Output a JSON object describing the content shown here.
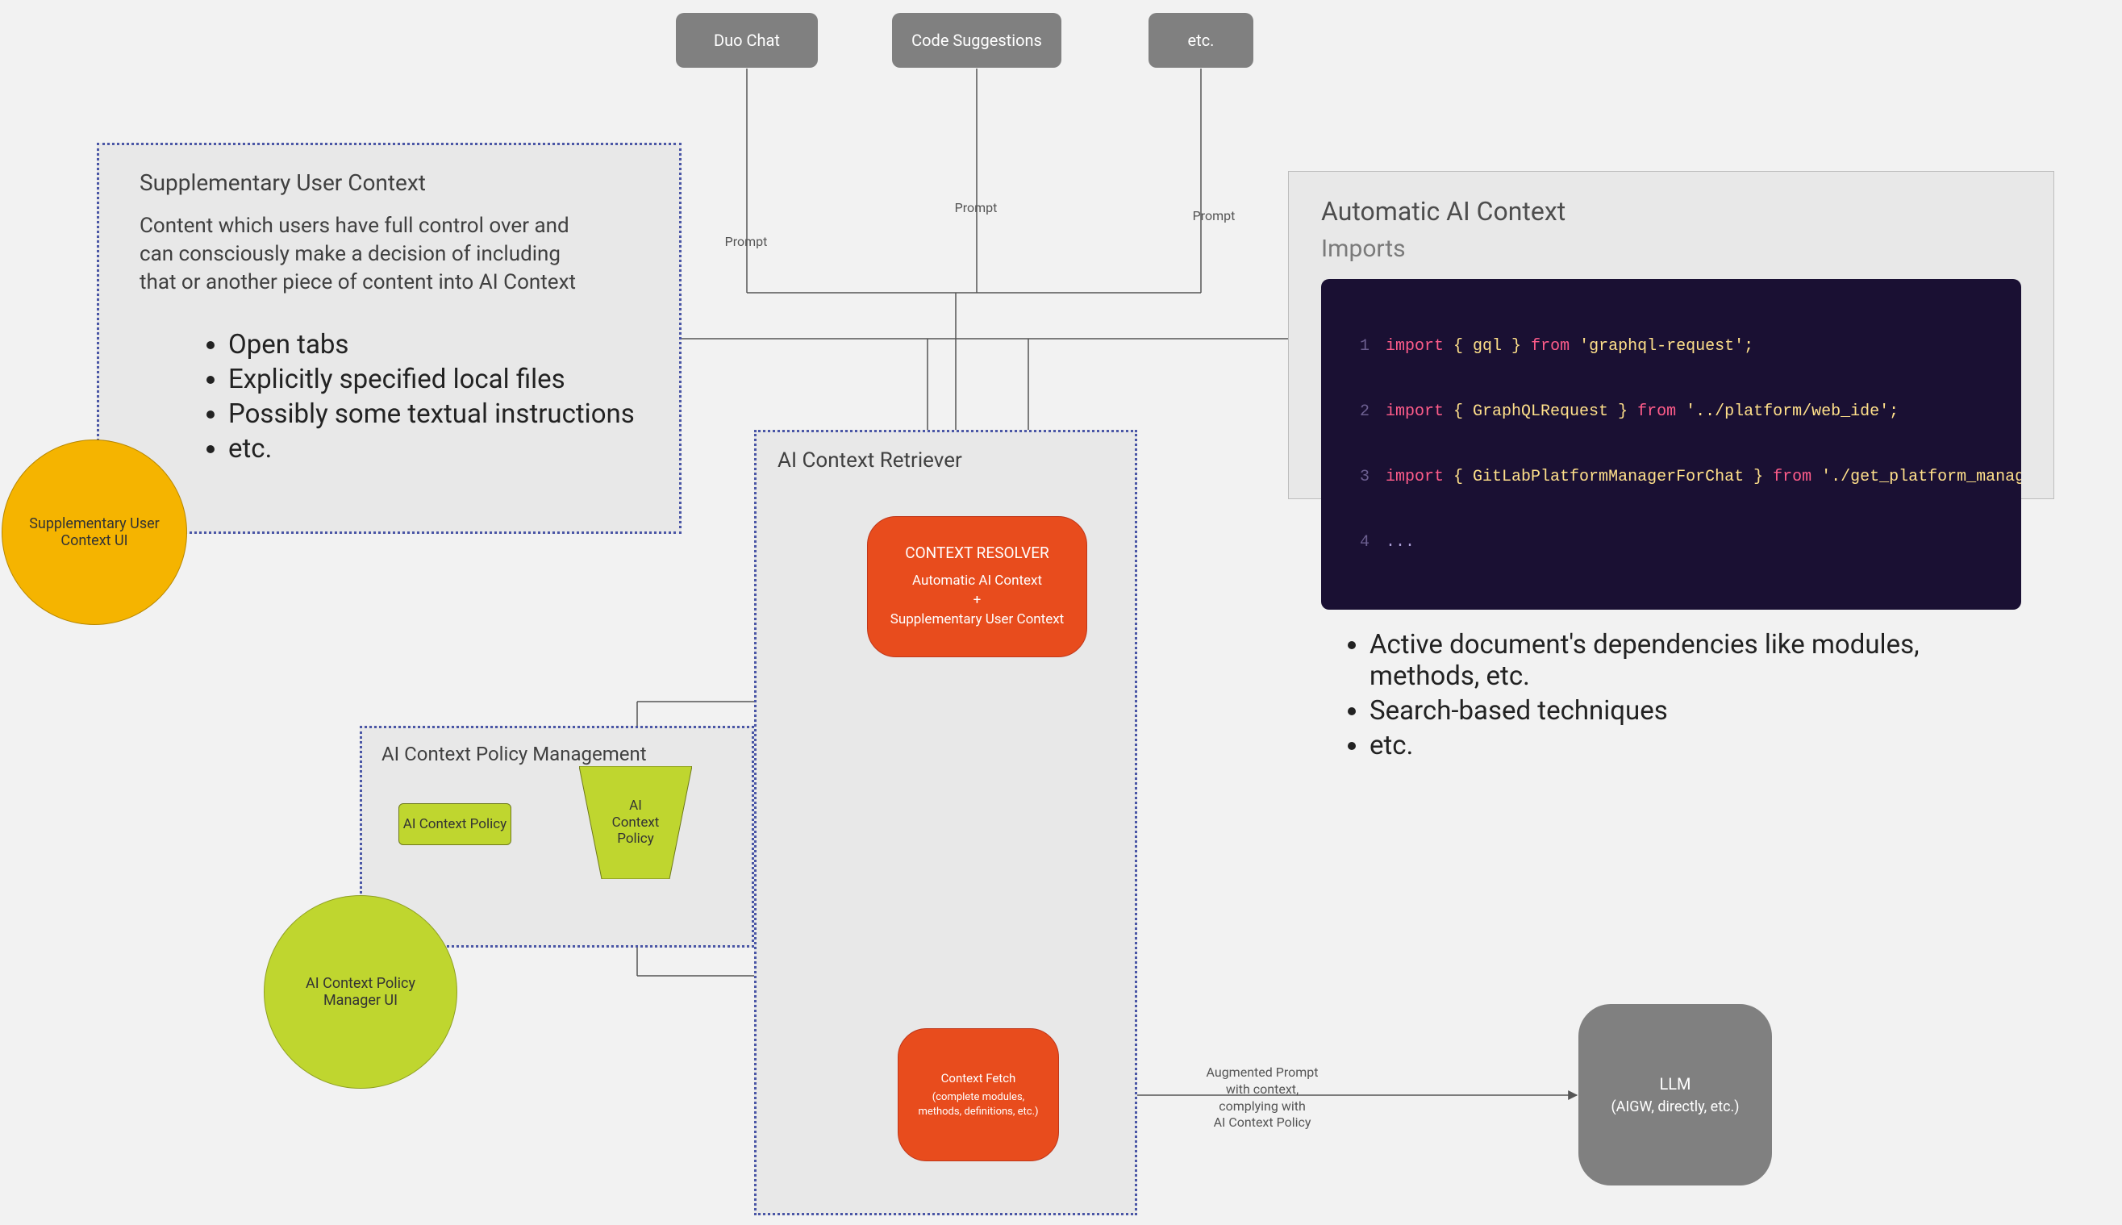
{
  "top_boxes": {
    "duo_chat": "Duo Chat",
    "code_suggestions": "Code Suggestions",
    "etc": "etc."
  },
  "edge_labels": {
    "prompt": "Prompt",
    "augmented_1": "Augmented Prompt",
    "augmented_2": "with context,",
    "augmented_3": "complying with",
    "augmented_4": "AI Context Policy"
  },
  "supp_panel": {
    "title": "Supplementary User Context",
    "body": "Content which users have full control over and can consciously make a decision of including that or another piece of content into AI Context",
    "bullets": [
      "Open tabs",
      "Explicitly specified local files",
      "Possibly some textual instructions",
      "etc."
    ]
  },
  "auto_panel": {
    "title": "Automatic AI Context",
    "subtitle": "Imports",
    "code": [
      {
        "n": "1",
        "kw": "import",
        "sym": "{ gql }",
        "from": "from",
        "str": "'graphql-request'",
        "tail": ";"
      },
      {
        "n": "2",
        "kw": "import",
        "sym": "{ GraphQLRequest }",
        "from": "from",
        "str": "'../platform/web_ide'",
        "tail": ";"
      },
      {
        "n": "3",
        "kw": "import",
        "sym": "{ GitLabPlatformManagerForChat }",
        "from": "from",
        "str": "'./get_platform_manager_for_chat'",
        "tail": ";"
      },
      {
        "n": "4",
        "plain": "..."
      }
    ],
    "bullets": [
      "Active document's dependencies like modules, methods, etc.",
      "Search-based techniques",
      "etc."
    ]
  },
  "retriever_panel": {
    "title": "AI Context Retriever"
  },
  "policy_panel": {
    "title": "AI Context Policy Management",
    "policy_box": "AI Context Policy",
    "trapezoid_l1": "AI",
    "trapezoid_l2": "Context",
    "trapezoid_l3": "Policy"
  },
  "circles": {
    "supp_ui_l1": "Supplementary User",
    "supp_ui_l2": "Context UI",
    "policy_ui_l1": "AI Context Policy",
    "policy_ui_l2": "Manager UI"
  },
  "resolver": {
    "hdr": "CONTEXT RESOLVER",
    "l1": "Automatic AI Context",
    "l2": "+",
    "l3": "Supplementary User Context"
  },
  "fetch": {
    "hdr": "Context Fetch",
    "sub": "(complete modules, methods, definitions, etc.)"
  },
  "llm": {
    "hdr": "LLM",
    "sub": "(AIGW, directly, etc.)"
  }
}
